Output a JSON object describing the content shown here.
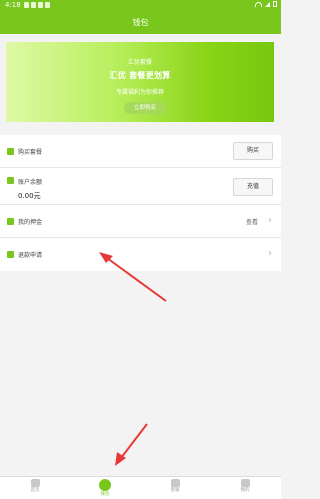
{
  "status_bar": {
    "time": "4:18"
  },
  "header": {
    "title": "钱包"
  },
  "banner": {
    "line1": "汇优套餐",
    "line2": "汇优 套餐更划算",
    "line3": "专属福利为你推荐",
    "button": "立即购买"
  },
  "list": {
    "buy_package": {
      "label": "购买套餐",
      "button": "购买"
    },
    "balance": {
      "label": "账户余额",
      "amount": "0.00元",
      "button": "充值"
    },
    "deposit": {
      "label": "我的押金",
      "action": "查看"
    },
    "refund": {
      "label": "退款申请"
    }
  },
  "tabs": [
    {
      "label": "首页"
    },
    {
      "label": "钱包"
    },
    {
      "label": "客服"
    },
    {
      "label": "我的"
    }
  ],
  "colors": {
    "accent": "#79c61d",
    "arrow": "#e53935"
  }
}
